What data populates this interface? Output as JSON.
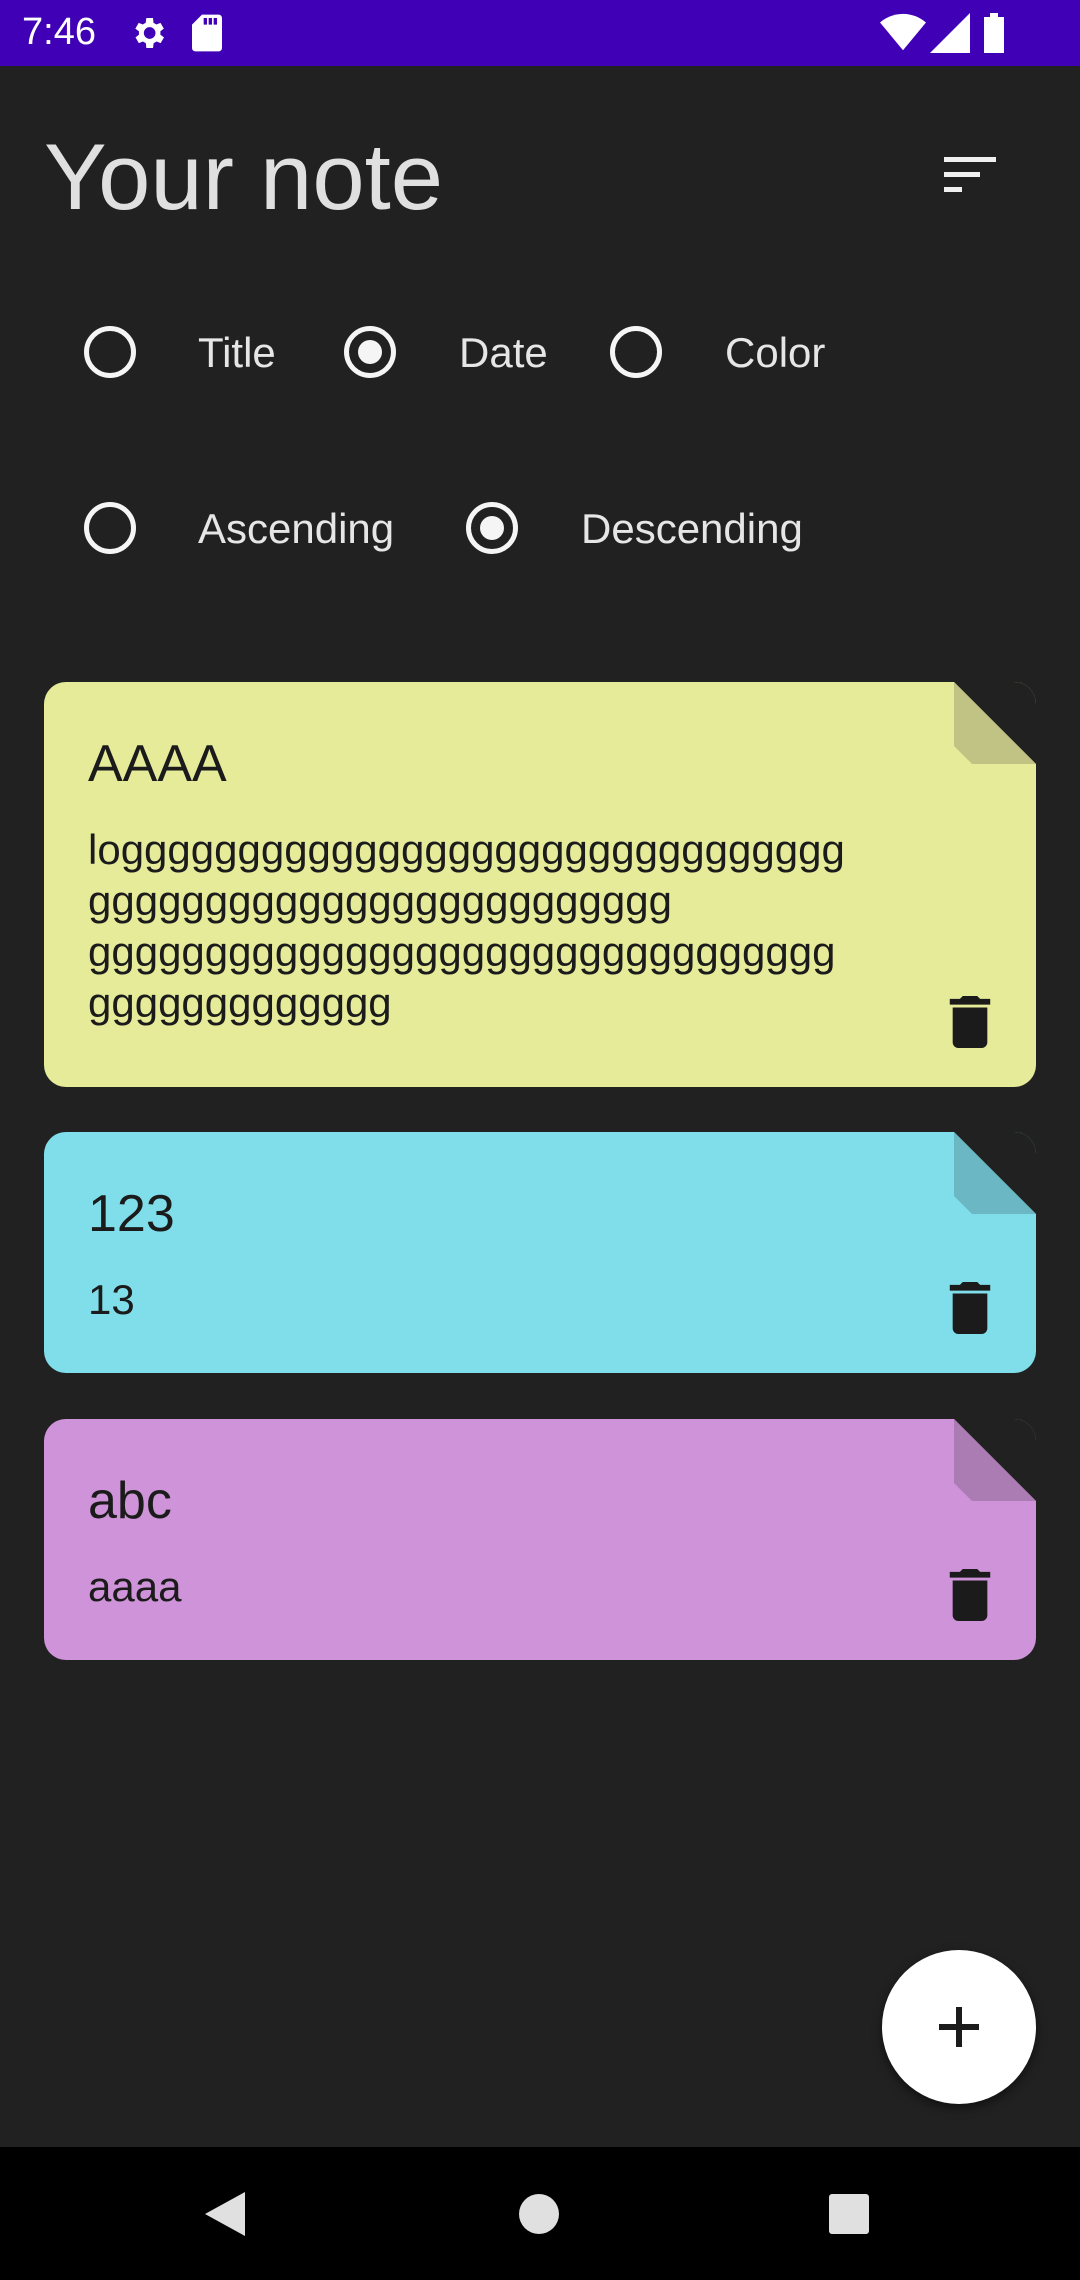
{
  "status": {
    "time": "7:46",
    "icons": [
      "gear-icon",
      "sd-card-icon",
      "wifi-icon",
      "signal-icon",
      "battery-icon"
    ]
  },
  "header": {
    "title": "Your note",
    "sort_icon": "sort-icon"
  },
  "order_by": {
    "options": [
      {
        "label": "Title",
        "checked": false
      },
      {
        "label": "Date",
        "checked": true
      },
      {
        "label": "Color",
        "checked": false
      }
    ]
  },
  "order_direction": {
    "options": [
      {
        "label": "Ascending",
        "checked": false
      },
      {
        "label": "Descending",
        "checked": true
      }
    ]
  },
  "notes": [
    {
      "title": "AAAA",
      "body": "loggggggggggggggggggggggggggggggg\nggggggggggggggggggggggggg\ngggggggggggggggggggggggggggggggg\nggggggggggggg",
      "color": "#e6eb9a",
      "fold_color": "#c0c384"
    },
    {
      "title": "123",
      "body": "13",
      "color": "#80deea",
      "fold_color": "#6bb8c4"
    },
    {
      "title": "abc",
      "body": "aaaa",
      "color": "#ce93d8",
      "fold_color": "#ab7bb4"
    }
  ],
  "fab": {
    "icon": "plus-icon"
  },
  "navigation": {
    "icons": [
      "back-icon",
      "home-icon",
      "recents-icon"
    ]
  }
}
